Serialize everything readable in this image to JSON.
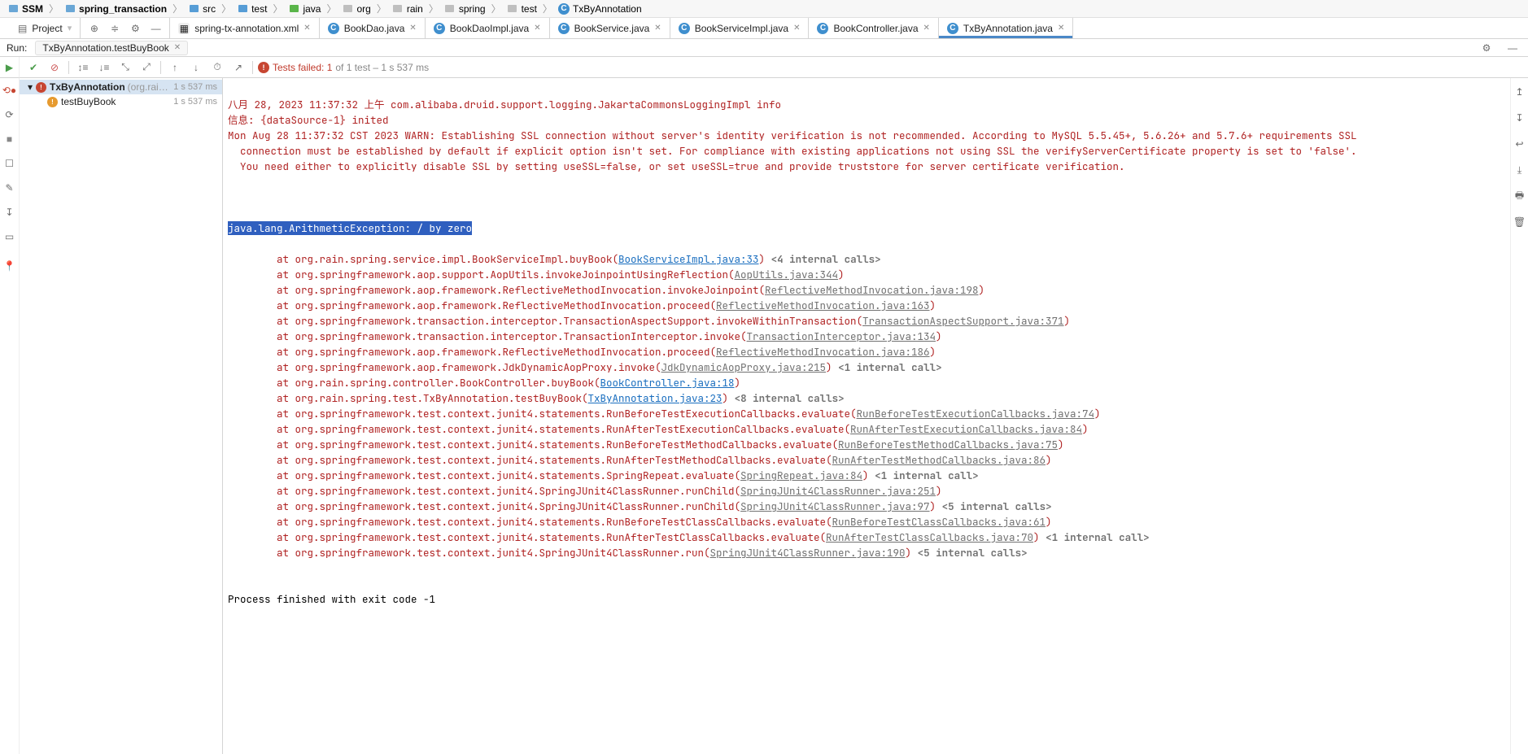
{
  "breadcrumbs": {
    "root": "SSM",
    "module": "spring_transaction",
    "p2": "src",
    "p3": "test",
    "p4": "java",
    "p5": "org",
    "p6": "rain",
    "p7": "spring",
    "p8": "test",
    "cls": "TxByAnnotation"
  },
  "project_dropdown": "Project",
  "tabs": {
    "t0": "spring-tx-annotation.xml",
    "t1": "BookDao.java",
    "t2": "BookDaoImpl.java",
    "t3": "BookService.java",
    "t4": "BookServiceImpl.java",
    "t5": "BookController.java",
    "t6": "TxByAnnotation.java"
  },
  "run": {
    "label": "Run:",
    "config": "TxByAnnotation.testBuyBook",
    "tests_failed": "Tests failed: 1",
    "tests_rest": " of 1 test – 1 s 537 ms"
  },
  "tree": {
    "class": "TxByAnnotation",
    "pkg": "(org.rain.spring.te",
    "class_time": "1 s 537 ms",
    "method": "testBuyBook",
    "method_time": "1 s 537 ms"
  },
  "console": {
    "l1": "八月 28, 2023 11:37:32 上午 com.alibaba.druid.support.logging.JakartaCommonsLoggingImpl info",
    "l2": "信息: {dataSource-1} inited",
    "l3a": "Mon Aug 28 11:37:32 CST 2023 WARN: Establishing SSL connection without server's identity verification is not recommended. According to MySQL 5.5.45+, 5.6.26+ and 5.7.6+ requirements SSL ",
    "l3b": "  connection must be established by default if explicit option isn't set. For compliance with existing applications not using SSL the verifyServerCertificate property is set to 'false'. ",
    "l3c": "  You need either to explicitly disable SSL by setting useSSL=false, or set useSSL=true and provide truststore for server certificate verification.",
    "ex": "java.lang.ArithmeticException: / by zero",
    "s1a": "\tat org.rain.spring.service.impl.BookServiceImpl.buyBook(",
    "s1b": "BookServiceImpl.java:33",
    "s1c": ")",
    "s1d": " <4 internal calls>",
    "s2a": "\tat org.springframework.aop.support.AopUtils.invokeJoinpointUsingReflection(",
    "s2b": "AopUtils.java:344",
    "s2c": ")",
    "s3a": "\tat org.springframework.aop.framework.ReflectiveMethodInvocation.invokeJoinpoint(",
    "s3b": "ReflectiveMethodInvocation.java:198",
    "s3c": ")",
    "s4a": "\tat org.springframework.aop.framework.ReflectiveMethodInvocation.proceed(",
    "s4b": "ReflectiveMethodInvocation.java:163",
    "s4c": ")",
    "s5a": "\tat org.springframework.transaction.interceptor.TransactionAspectSupport.invokeWithinTransaction(",
    "s5b": "TransactionAspectSupport.java:371",
    "s5c": ")",
    "s6a": "\tat org.springframework.transaction.interceptor.TransactionInterceptor.invoke(",
    "s6b": "TransactionInterceptor.java:134",
    "s6c": ")",
    "s7a": "\tat org.springframework.aop.framework.ReflectiveMethodInvocation.proceed(",
    "s7b": "ReflectiveMethodInvocation.java:186",
    "s7c": ")",
    "s8a": "\tat org.springframework.aop.framework.JdkDynamicAopProxy.invoke(",
    "s8b": "JdkDynamicAopProxy.java:215",
    "s8c": ")",
    "s8d": " <1 internal call>",
    "s9a": "\tat org.rain.spring.controller.BookController.buyBook(",
    "s9b": "BookController.java:18",
    "s9c": ")",
    "s10a": "\tat org.rain.spring.test.TxByAnnotation.testBuyBook(",
    "s10b": "TxByAnnotation.java:23",
    "s10c": ")",
    "s10d": " <8 internal calls>",
    "s11a": "\tat org.springframework.test.context.junit4.statements.RunBeforeTestExecutionCallbacks.evaluate(",
    "s11b": "RunBeforeTestExecutionCallbacks.java:74",
    "s11c": ")",
    "s12a": "\tat org.springframework.test.context.junit4.statements.RunAfterTestExecutionCallbacks.evaluate(",
    "s12b": "RunAfterTestExecutionCallbacks.java:84",
    "s12c": ")",
    "s13a": "\tat org.springframework.test.context.junit4.statements.RunBeforeTestMethodCallbacks.evaluate(",
    "s13b": "RunBeforeTestMethodCallbacks.java:75",
    "s13c": ")",
    "s14a": "\tat org.springframework.test.context.junit4.statements.RunAfterTestMethodCallbacks.evaluate(",
    "s14b": "RunAfterTestMethodCallbacks.java:86",
    "s14c": ")",
    "s15a": "\tat org.springframework.test.context.junit4.statements.SpringRepeat.evaluate(",
    "s15b": "SpringRepeat.java:84",
    "s15c": ")",
    "s15d": " <1 internal call>",
    "s16a": "\tat org.springframework.test.context.junit4.SpringJUnit4ClassRunner.runChild(",
    "s16b": "SpringJUnit4ClassRunner.java:251",
    "s16c": ")",
    "s17a": "\tat org.springframework.test.context.junit4.SpringJUnit4ClassRunner.runChild(",
    "s17b": "SpringJUnit4ClassRunner.java:97",
    "s17c": ")",
    "s17d": " <5 internal calls>",
    "s18a": "\tat org.springframework.test.context.junit4.statements.RunBeforeTestClassCallbacks.evaluate(",
    "s18b": "RunBeforeTestClassCallbacks.java:61",
    "s18c": ")",
    "s19a": "\tat org.springframework.test.context.junit4.statements.RunAfterTestClassCallbacks.evaluate(",
    "s19b": "RunAfterTestClassCallbacks.java:70",
    "s19c": ")",
    "s19d": " <1 internal call>",
    "s20a": "\tat org.springframework.test.context.junit4.SpringJUnit4ClassRunner.run(",
    "s20b": "SpringJUnit4ClassRunner.java:190",
    "s20c": ")",
    "s20d": " <5 internal calls>",
    "exit": "Process finished with exit code -1"
  }
}
